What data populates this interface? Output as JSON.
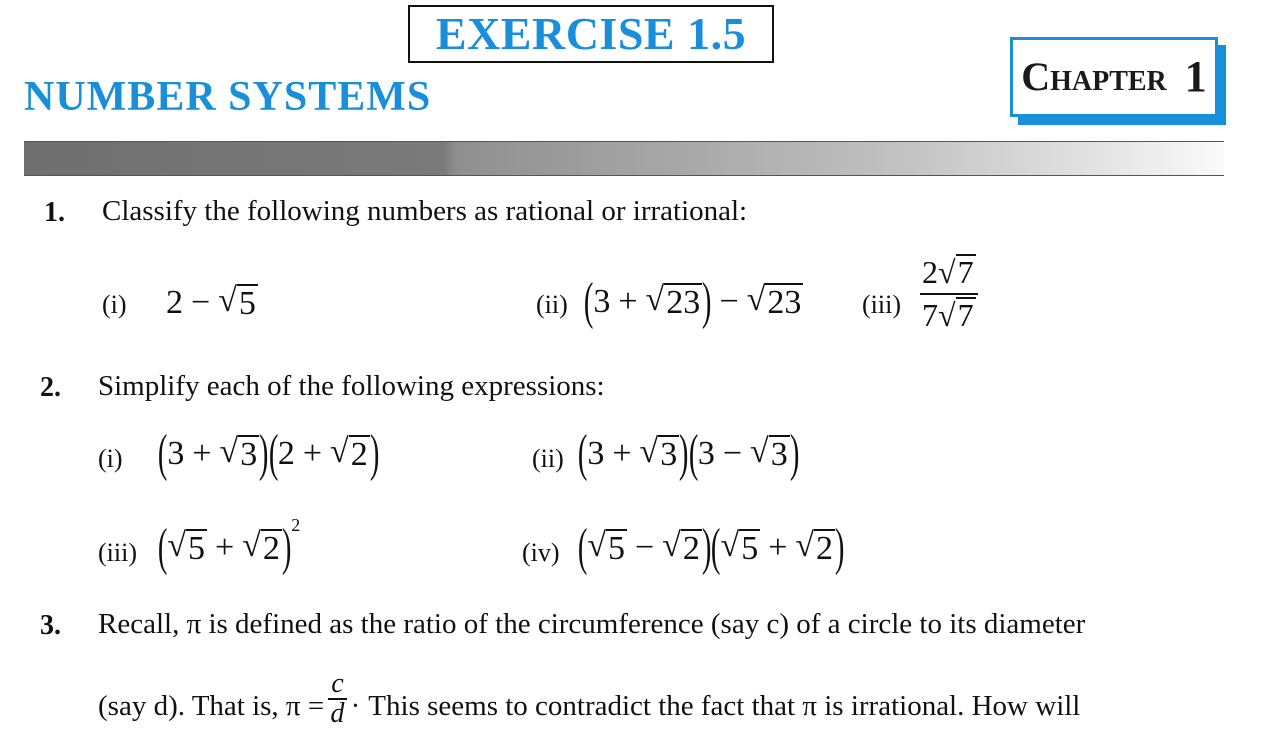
{
  "header": {
    "exercise_title": "EXERCISE 1.5",
    "section_title": "NUMBER SYSTEMS",
    "chapter_label": "Chapter",
    "chapter_number": "1",
    "accent_color": "#1a8fd9"
  },
  "questions": [
    {
      "number": "1.",
      "text": "Classify the following numbers as rational or irrational:",
      "parts": [
        {
          "label": "(i)",
          "expr": "2 − √5"
        },
        {
          "label": "(ii)",
          "expr": "(3 + √23) − √23"
        },
        {
          "label": "(iii)",
          "expr": "2√7 / 7√7"
        }
      ]
    },
    {
      "number": "2.",
      "text": "Simplify each of the following expressions:",
      "parts": [
        {
          "label": "(i)",
          "expr": "(3 + √3)(2 + √2)"
        },
        {
          "label": "(ii)",
          "expr": "(3 + √3)(3 − √3)"
        },
        {
          "label": "(iii)",
          "expr": "(√5 + √2)²"
        },
        {
          "label": "(iv)",
          "expr": "(√5 − √2)(√5 + √2)"
        }
      ]
    },
    {
      "number": "3.",
      "text_line1": "Recall, π is defined as the ratio of the circumference (say c) of a circle to its diameter",
      "text_line2_a": "(say d). That is, π =",
      "text_line2_b": "This seems to contradict the fact that π is irrational. How will"
    }
  ],
  "glyphs": {
    "two": "2",
    "three": "3",
    "five": "5",
    "seven": "7",
    "twentythree": "23",
    "plus": "+",
    "minus": "−",
    "radical": "√",
    "lparen": "(",
    "rparen": ")",
    "squared": "2",
    "c": "c",
    "d": "d",
    "dot": "·"
  }
}
